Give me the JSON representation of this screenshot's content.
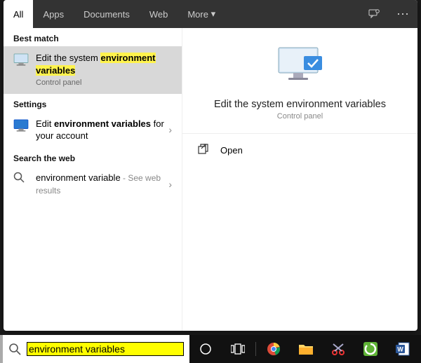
{
  "tabs": {
    "all": "All",
    "apps": "Apps",
    "documents": "Documents",
    "web": "Web",
    "more": "More"
  },
  "left": {
    "best_match_hdr": "Best match",
    "best_match": {
      "pre": "Edit the system ",
      "hl1": "environment",
      "hl2": "variables",
      "sub": "Control panel"
    },
    "settings_hdr": "Settings",
    "settings_item": {
      "pre": "Edit ",
      "bold": "environment variables",
      "post": " for your account"
    },
    "web_hdr": "Search the web",
    "web_item": {
      "term": "environment variable",
      "tail": " - See web results"
    }
  },
  "preview": {
    "title": "Edit the system environment variables",
    "sub": "Control panel"
  },
  "actions": {
    "open": "Open"
  },
  "search": {
    "value": "environment variables"
  },
  "icons": {
    "chevron": "›",
    "chevron_down": "▾",
    "more": "⋯"
  }
}
